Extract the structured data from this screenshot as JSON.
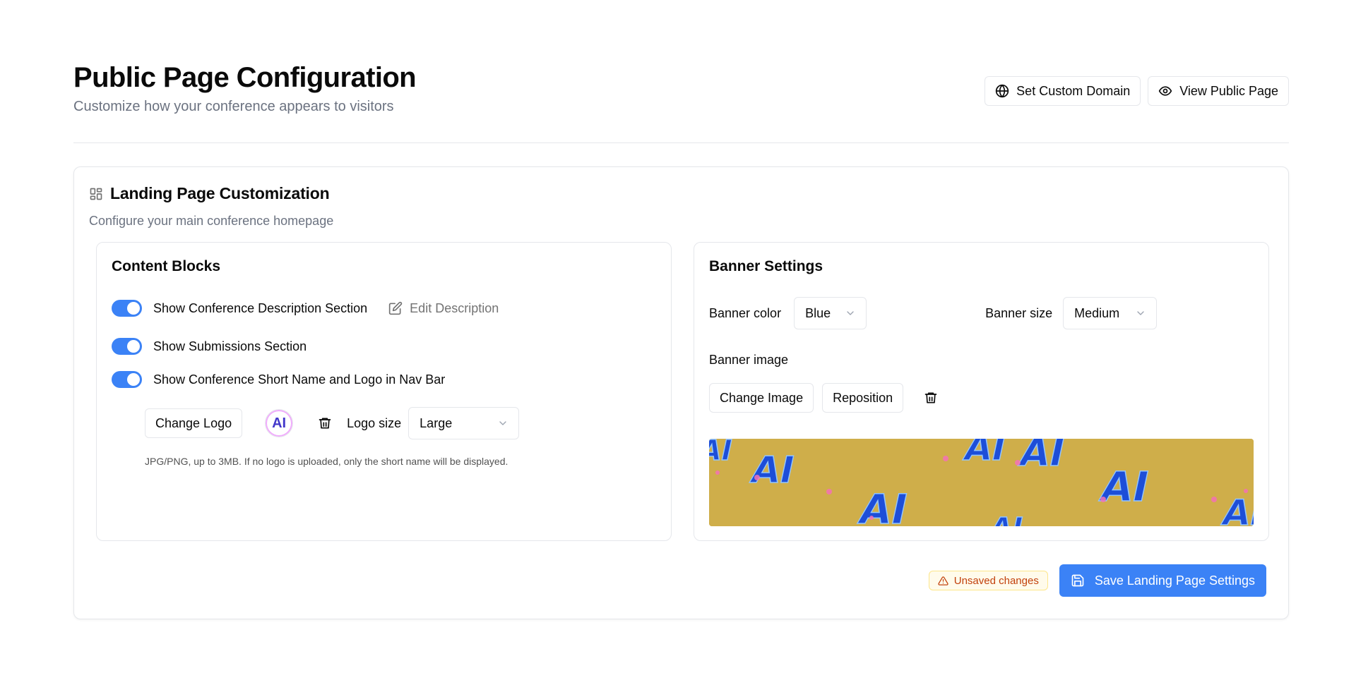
{
  "header": {
    "title": "Public Page Configuration",
    "subtitle": "Customize how your conference appears to visitors",
    "actions": {
      "custom_domain": {
        "label": "Set Custom Domain",
        "icon": "globe-icon"
      },
      "view_public": {
        "label": "View Public Page",
        "icon": "eye-icon"
      }
    }
  },
  "card": {
    "icon": "layout-grid-icon",
    "title": "Landing Page Customization",
    "subtitle": "Configure your main conference homepage",
    "content_blocks": {
      "title": "Content Blocks",
      "toggles": [
        {
          "label": "Show Conference Description Section",
          "checked": true
        },
        {
          "label": "Show Submissions Section",
          "checked": true
        },
        {
          "label": "Show Conference Short Name and Logo in Nav Bar",
          "checked": true
        }
      ],
      "edit_description": "Edit Description",
      "change_logo": "Change Logo",
      "logo_text": "AI",
      "logo_size_label": "Logo size",
      "logo_size_value": "Large",
      "hint": "JPG/PNG, up to 3MB. If no logo is uploaded, only the short name will be displayed."
    },
    "banner": {
      "title": "Banner Settings",
      "color_label": "Banner color",
      "color_value": "Blue",
      "size_label": "Banner size",
      "size_value": "Medium",
      "image_label": "Banner image",
      "change_image": "Change Image",
      "reposition": "Reposition",
      "preview_bg": "#cfae4a",
      "preview_letter_color": "#1d4ed8",
      "preview_letters": [
        "AI",
        "AI",
        "AI",
        "AI",
        "AI",
        "AI",
        "AI",
        "AI"
      ]
    },
    "footer": {
      "unsaved": "Unsaved changes",
      "save": "Save Landing Page Settings"
    }
  },
  "colors": {
    "accent": "#3b82f6",
    "warning_text": "#c2410c",
    "warning_bg": "#fffbeb",
    "muted": "#6b7280"
  }
}
